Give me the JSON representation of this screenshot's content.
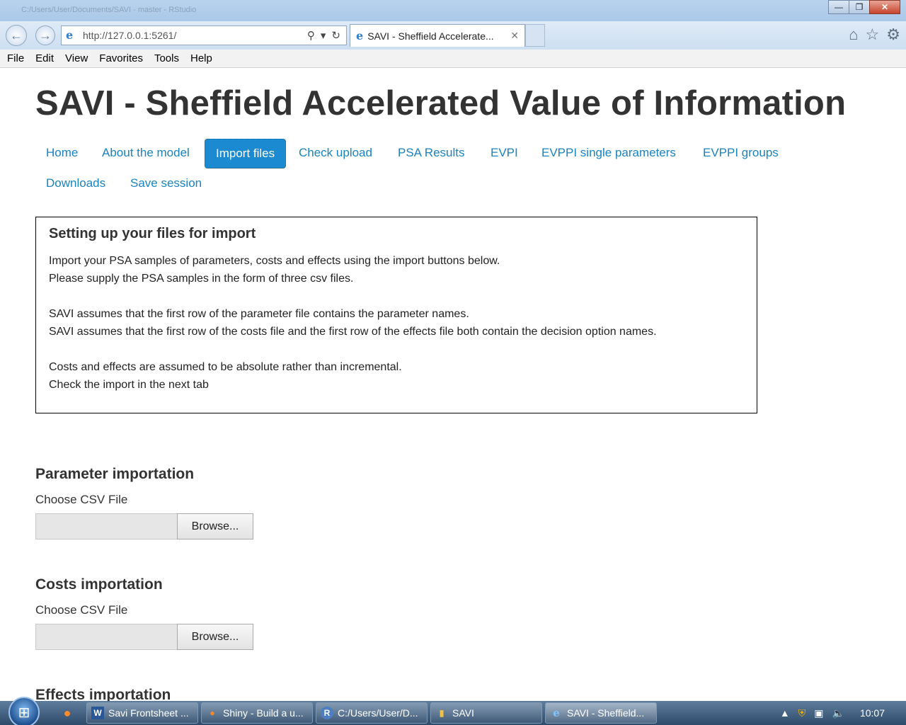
{
  "window": {
    "titlebar_path": "C:/Users/User/Documents/SAVI - master - RStudio",
    "minimize_glyph": "—",
    "restore_glyph": "❐",
    "close_glyph": "✕"
  },
  "browser": {
    "back_glyph": "←",
    "forward_glyph": "→",
    "ie_glyph": "e",
    "address": "http://127.0.0.1:5261/",
    "search_glyph": "⚲",
    "dropdown_glyph": "▾",
    "refresh_glyph": "↻",
    "tab_title": "SAVI - Sheffield Accelerate...",
    "tab_close_glyph": "✕",
    "home_glyph": "⌂",
    "favorites_glyph": "☆",
    "settings_glyph": "⚙"
  },
  "menubar": {
    "items": [
      "File",
      "Edit",
      "View",
      "Favorites",
      "Tools",
      "Help"
    ]
  },
  "page": {
    "title": "SAVI - Sheffield Accelerated Value of Information",
    "nav": [
      {
        "label": "Home",
        "active": false
      },
      {
        "label": "About the model",
        "active": false
      },
      {
        "label": "Import files",
        "active": true
      },
      {
        "label": "Check upload",
        "active": false
      },
      {
        "label": "PSA Results",
        "active": false
      },
      {
        "label": "EVPI",
        "active": false
      },
      {
        "label": "EVPPI single parameters",
        "active": false
      },
      {
        "label": "EVPPI groups",
        "active": false
      },
      {
        "label": "Downloads",
        "active": false
      },
      {
        "label": "Save session",
        "active": false
      }
    ],
    "info": {
      "heading": "Setting up your files for import",
      "line1": "Import your PSA samples of parameters, costs and effects using the import buttons below.",
      "line2": "Please supply the PSA samples in the form of three csv files.",
      "line3": "SAVI assumes that the first row of the parameter file contains the parameter names.",
      "line4": "SAVI assumes that the first row of the costs file and the first row of the effects file both contain the decision option names.",
      "line5": "Costs and effects are assumed to be absolute rather than incremental.",
      "line6": "Check the import in the next tab"
    },
    "parameter": {
      "heading": "Parameter importation",
      "label": "Choose CSV File",
      "button": "Browse..."
    },
    "costs": {
      "heading": "Costs importation",
      "label": "Choose CSV File",
      "button": "Browse..."
    },
    "effects": {
      "heading": "Effects importation"
    }
  },
  "taskbar": {
    "start_glyph": "⊞",
    "firefox_glyph": "●",
    "buttons": [
      {
        "icon": "W",
        "label": "Savi Frontsheet ..."
      },
      {
        "icon": "●",
        "label": "Shiny - Build a u..."
      },
      {
        "icon": "R",
        "label": "C:/Users/User/D..."
      },
      {
        "icon": "▮",
        "label": "SAVI"
      },
      {
        "icon": "e",
        "label": "SAVI - Sheffield..."
      }
    ],
    "tray_arrow": "▲",
    "tray_shield": "⛨",
    "tray_network": "▣",
    "tray_volume": "🔈",
    "clock": "10:07"
  }
}
